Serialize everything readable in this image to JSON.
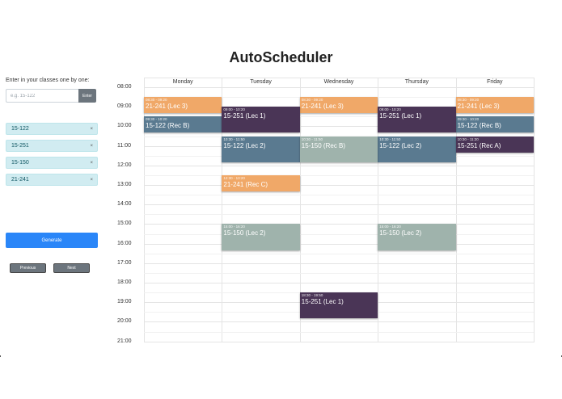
{
  "app": {
    "title": "AutoScheduler"
  },
  "sidebar": {
    "prompt": "Enter in your classes one by one:",
    "input_placeholder": "e.g. 15-122",
    "enter_label": "Enter",
    "courses": [
      {
        "name": "15-122",
        "remove": "×"
      },
      {
        "name": "15-251",
        "remove": "×"
      },
      {
        "name": "15-150",
        "remove": "×"
      },
      {
        "name": "21-241",
        "remove": "×"
      }
    ],
    "generate_label": "Generate",
    "previous_label": "Previous",
    "next_label": "Next"
  },
  "calendar": {
    "days": [
      "Monday",
      "Tuesday",
      "Wednesday",
      "Thursday",
      "Friday"
    ],
    "hours": [
      "08:00",
      "09:00",
      "10:00",
      "11:00",
      "12:00",
      "13:00",
      "14:00",
      "15:00",
      "16:00",
      "17:00",
      "18:00",
      "19:00",
      "20:00",
      "21:00"
    ],
    "events": [
      {
        "day": 0,
        "start": 8.5,
        "end": 9.33,
        "time": "08:30 - 09:20",
        "name": "21-241 (Lec 3)",
        "color": "#f0a868"
      },
      {
        "day": 2,
        "start": 8.5,
        "end": 9.33,
        "time": "08:30 - 09:20",
        "name": "21-241 (Lec 3)",
        "color": "#f0a868"
      },
      {
        "day": 4,
        "start": 8.5,
        "end": 9.33,
        "time": "08:30 - 09:20",
        "name": "21-241 (Lec 3)",
        "color": "#f0a868"
      },
      {
        "day": 0,
        "start": 9.5,
        "end": 10.33,
        "time": "09:30 - 10:20",
        "name": "15-122 (Rec B)",
        "color": "#5a7a90"
      },
      {
        "day": 4,
        "start": 9.5,
        "end": 10.33,
        "time": "09:30 - 10:20",
        "name": "15-122 (Rec B)",
        "color": "#5a7a90"
      },
      {
        "day": 1,
        "start": 9.0,
        "end": 10.33,
        "time": "09:00 - 10:20",
        "name": "15-251 (Lec 1)",
        "color": "#4a3556"
      },
      {
        "day": 3,
        "start": 9.0,
        "end": 10.33,
        "time": "09:00 - 10:20",
        "name": "15-251 (Lec 1)",
        "color": "#4a3556"
      },
      {
        "day": 1,
        "start": 10.5,
        "end": 11.83,
        "time": "10:30 - 11:50",
        "name": "15-122 (Lec 2)",
        "color": "#5a7a90"
      },
      {
        "day": 3,
        "start": 10.5,
        "end": 11.83,
        "time": "10:30 - 11:50",
        "name": "15-122 (Lec 2)",
        "color": "#5a7a90"
      },
      {
        "day": 2,
        "start": 10.5,
        "end": 11.83,
        "time": "10:30 - 11:50",
        "name": "15-150 (Rec B)",
        "color": "#9fb3ac"
      },
      {
        "day": 4,
        "start": 10.5,
        "end": 11.33,
        "time": "10:30 - 11:20",
        "name": "15-251 (Rec A)",
        "color": "#4a3556"
      },
      {
        "day": 1,
        "start": 12.5,
        "end": 13.33,
        "time": "12:30 - 13:20",
        "name": "21-241 (Rec C)",
        "color": "#f0a868"
      },
      {
        "day": 1,
        "start": 15.0,
        "end": 16.33,
        "time": "15:00 - 16:20",
        "name": "15-150 (Lec 2)",
        "color": "#9fb3ac"
      },
      {
        "day": 3,
        "start": 15.0,
        "end": 16.33,
        "time": "15:00 - 16:20",
        "name": "15-150 (Lec 2)",
        "color": "#9fb3ac"
      },
      {
        "day": 2,
        "start": 18.5,
        "end": 19.83,
        "time": "18:30 - 19:50",
        "name": "15-251 (Lec 1)",
        "color": "#4a3556"
      }
    ]
  }
}
